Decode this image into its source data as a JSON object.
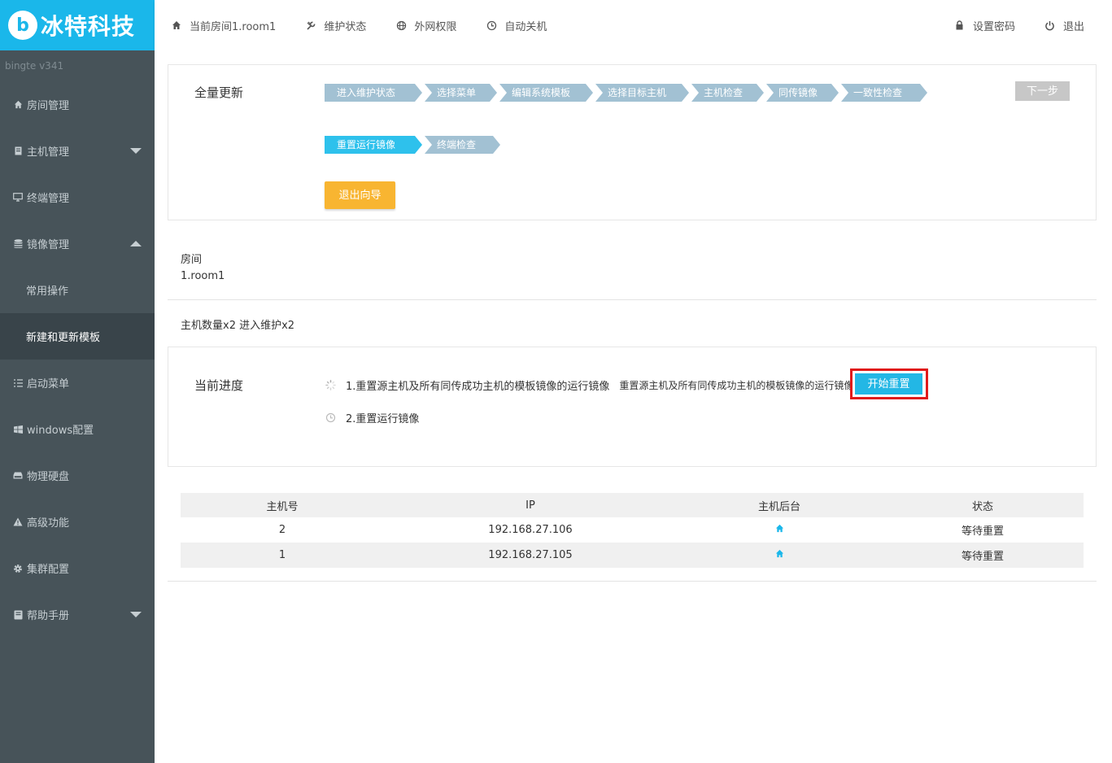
{
  "brand": {
    "logo_letter": "b",
    "name": "冰特科技",
    "version": "bingte  v341"
  },
  "topnav": {
    "items": [
      {
        "label": "当前房间1.room1",
        "icon": "home-icon"
      },
      {
        "label": "维护状态",
        "icon": "wrench-icon"
      },
      {
        "label": "外网权限",
        "icon": "globe-icon"
      },
      {
        "label": "自动关机",
        "icon": "clock-icon"
      }
    ],
    "right": [
      {
        "label": "设置密码",
        "icon": "lock-icon"
      },
      {
        "label": "退出",
        "icon": "power-icon"
      }
    ]
  },
  "sidebar": {
    "items": [
      {
        "label": "房间管理",
        "icon": "home-icon"
      },
      {
        "label": "主机管理",
        "icon": "server-icon",
        "caret": "down"
      },
      {
        "label": "终端管理",
        "icon": "monitor-icon"
      },
      {
        "label": "镜像管理",
        "icon": "database-icon",
        "caret": "up"
      },
      {
        "label": "启动菜单",
        "icon": "list-icon"
      },
      {
        "label": "windows配置",
        "icon": "windows-icon"
      },
      {
        "label": "物理硬盘",
        "icon": "hdd-icon"
      },
      {
        "label": "高级功能",
        "icon": "warning-icon"
      },
      {
        "label": "集群配置",
        "icon": "gear-icon"
      },
      {
        "label": "帮助手册",
        "icon": "book-icon",
        "caret": "down"
      }
    ],
    "sub_items": [
      {
        "label": "常用操作"
      },
      {
        "label": "新建和更新模板",
        "active": true
      }
    ]
  },
  "wizard": {
    "title": "全量更新",
    "steps_row1": [
      "进入维护状态",
      "选择菜单",
      "编辑系统模板",
      "选择目标主机",
      "主机检查",
      "同传镜像",
      "一致性检查"
    ],
    "steps_row2": [
      "重置运行镜像",
      "终端检查"
    ],
    "current_step": "重置运行镜像",
    "next_label": "下一步",
    "exit_label": "退出向导"
  },
  "room": {
    "label": "房间",
    "value": "1.room1",
    "host_summary": "主机数量x2 进入维护x2"
  },
  "progress": {
    "title": "当前进度",
    "step1_text": "1.重置源主机及所有同传成功主机的模板镜像的运行镜像",
    "step1_detail": "重置源主机及所有同传成功主机的模板镜像的运行镜像",
    "step2_text": "2.重置运行镜像",
    "reset_button": "开始重置"
  },
  "table": {
    "headers": [
      "主机号",
      "IP",
      "主机后台",
      "状态"
    ],
    "rows": [
      {
        "id": "2",
        "ip": "192.168.27.106",
        "status": "等待重置"
      },
      {
        "id": "1",
        "ip": "192.168.27.105",
        "status": "等待重置"
      }
    ]
  },
  "colors": {
    "brand": "#1ab7ea",
    "sidebar": "#475359",
    "step_current": "#2ec1ec",
    "step_default": "#a2c1d3",
    "exit_button": "#f8b531",
    "highlight": "#e01b1b"
  }
}
